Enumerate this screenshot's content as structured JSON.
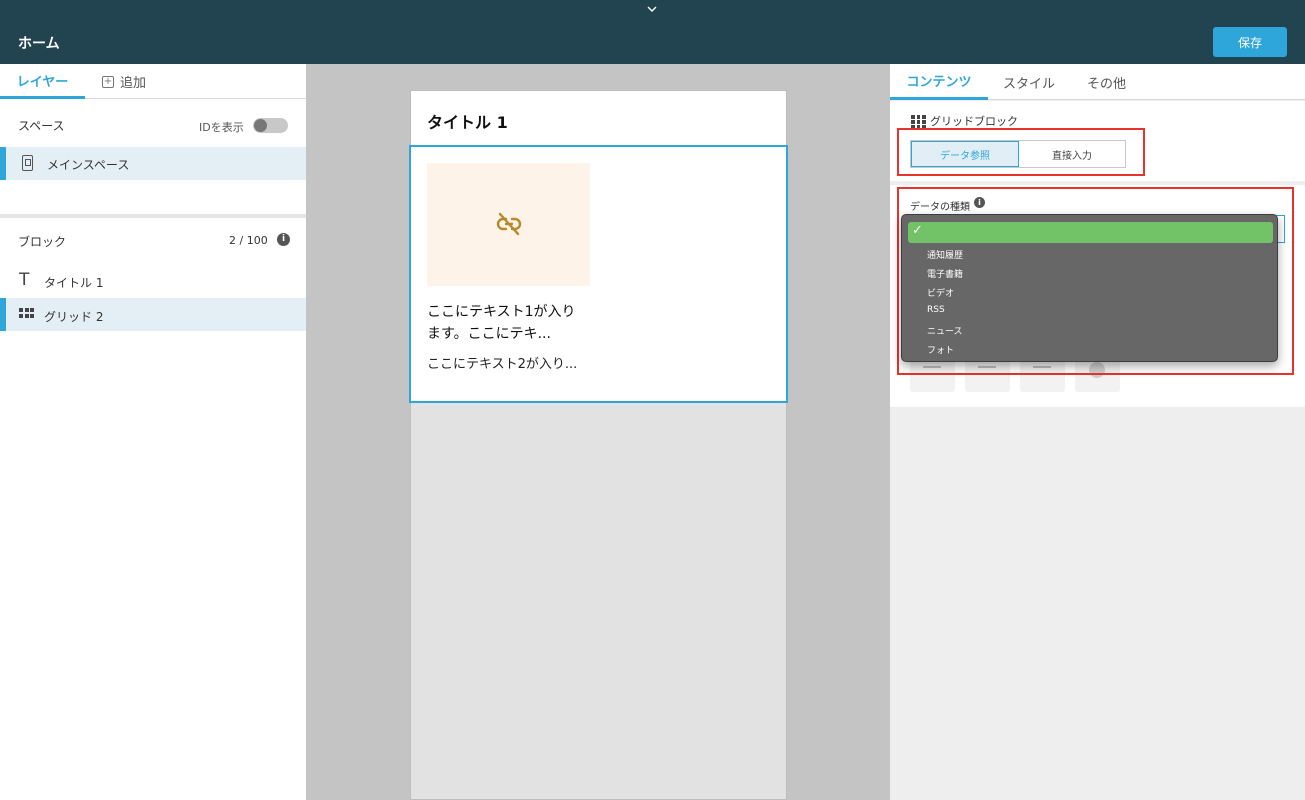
{
  "header": {
    "title": "ホーム",
    "save_label": "保存"
  },
  "left_panel": {
    "tabs": [
      {
        "label": "レイヤー",
        "active": true
      },
      {
        "label": "追加",
        "active": false
      }
    ],
    "spaces": {
      "heading": "スペース",
      "show_id_label": "IDを表示",
      "items": [
        {
          "label": "メインスペース"
        }
      ]
    },
    "blocks": {
      "heading": "ブロック",
      "count": "2 / 100",
      "items": [
        {
          "icon": "text-t-icon",
          "label": "タイトル 1"
        },
        {
          "icon": "grid-icon",
          "label": "グリッド 2"
        }
      ]
    }
  },
  "preview": {
    "title_block": "タイトル 1",
    "grid_item": {
      "image_icon": "broken-link-icon",
      "text1": "ここにテキスト1が入ります。ここにテキ...",
      "text2": "ここにテキスト2が入り..."
    }
  },
  "right_panel": {
    "tabs": [
      {
        "label": "コンテンツ",
        "active": true
      },
      {
        "label": "スタイル",
        "active": false
      },
      {
        "label": "その他",
        "active": false
      }
    ],
    "section_title": "グリッドブロック",
    "mode_toggle": [
      {
        "label": "データ参照",
        "selected": true
      },
      {
        "label": "直接入力",
        "selected": false
      }
    ],
    "data_type_label": "データの種類",
    "data_type_menu": {
      "selected": "",
      "options": [
        "通知履歴",
        "電子書籍",
        "ビデオ",
        "RSS",
        "ニュース",
        "フォト"
      ]
    }
  },
  "colors": {
    "topbar": "#214450",
    "accent": "#2fa6d9",
    "highlight": "#e8332a",
    "menu_selected": "#72c367"
  }
}
